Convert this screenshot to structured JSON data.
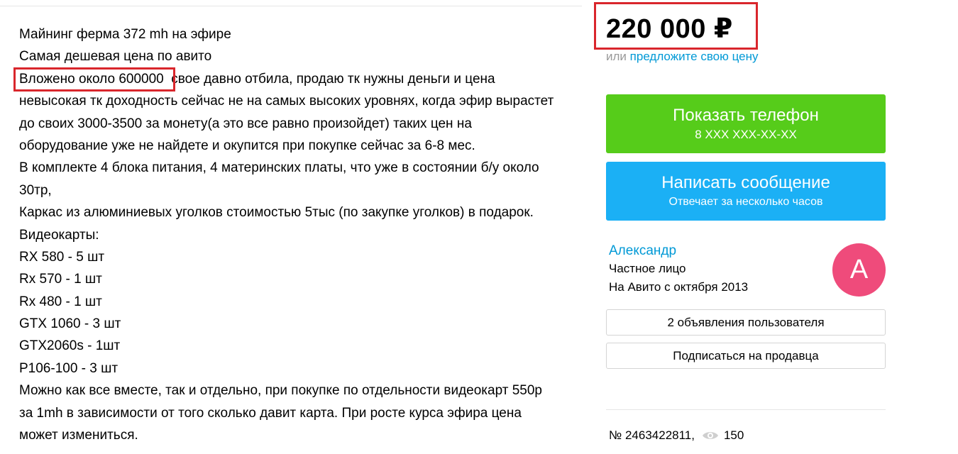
{
  "description": {
    "lines": [
      "Майнинг ферма 372 mh на эфире",
      "Самая дешевая цена по авито",
      "Вложено около 600000  свое давно отбила, продаю тк нужны деньги и цена",
      "невысокая тк доходность сейчас не на самых высоких уровнях, когда эфир вырастет",
      "до своих 3000-3500 за монету(а это все равно произойдет) таких цен на",
      "оборудование уже не найдете и окупится при покупке сейчас за 6-8 мес.",
      "В комплекте 4 блока питания, 4 материнских платы, что уже в состоянии б/у около",
      "30тр,",
      "Каркас из алюминиевых уголков стоимостью 5тыс (по закупке уголков) в подарок.",
      "Видеокарты:",
      "RX 580 - 5 шт",
      "Rx 570 - 1 шт",
      "Rx 480 - 1 шт",
      "GTX 1060 - 3 шт",
      "GTX2060s - 1шт",
      "P106-100 - 3 шт",
      "Можно как все вместе, так и отдельно, при покупке по отдельности видеокарт 550р",
      "за 1mh в зависимости от того сколько давит карта. При росте курса эфира цена",
      "может измениться."
    ]
  },
  "price": {
    "value": "220 000 ₽",
    "offer_prefix": "или",
    "offer_link": "предложите свою цену"
  },
  "buttons": {
    "phone_title": "Показать телефон",
    "phone_sub": "8 XXX XXX-XX-XX",
    "message_title": "Написать сообщение",
    "message_sub": "Отвечает за несколько часов",
    "ads": "2 объявления пользователя",
    "subscribe": "Подписаться на продавца"
  },
  "seller": {
    "name": "Александр",
    "type": "Частное лицо",
    "since": "На Авито с октября 2013",
    "avatar_letter": "А"
  },
  "meta": {
    "listing_number": "№ 2463422811,",
    "views": "150"
  },
  "colors": {
    "highlight": "#d9262c",
    "phone_button": "#56cc1a",
    "message_button": "#1bb0f5",
    "link": "#0099d6",
    "avatar": "#ef4b7b"
  }
}
